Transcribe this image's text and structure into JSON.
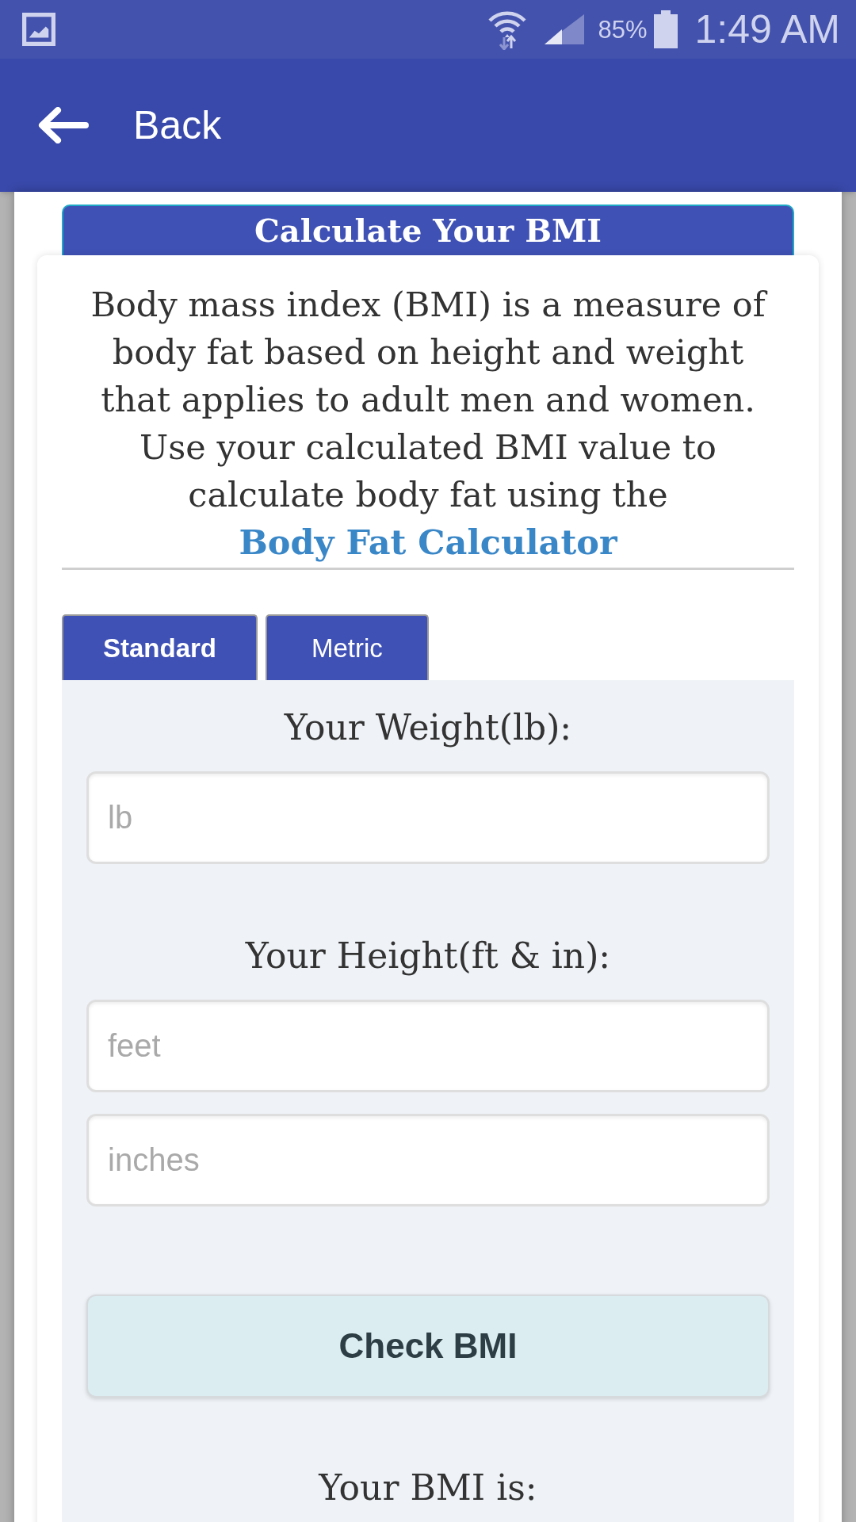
{
  "status_bar": {
    "battery": "85%",
    "time": "1:49 AM"
  },
  "app_bar": {
    "back_label": "Back"
  },
  "card": {
    "title": "Calculate Your BMI",
    "intro": "Body mass index (BMI) is a measure of body fat based on height and weight that applies to adult men and women. Use your calculated BMI value to calculate body fat using the",
    "link": "Body Fat Calculator"
  },
  "tabs": [
    {
      "label": "Standard",
      "selected": true
    },
    {
      "label": "Metric",
      "selected": false
    }
  ],
  "form": {
    "sections": [
      {
        "label": "Your Weight(lb):",
        "fields": [
          {
            "placeholder": "lb"
          }
        ]
      },
      {
        "label": "Your Height(ft & in):",
        "fields": [
          {
            "placeholder": "feet"
          },
          {
            "placeholder": "inches"
          }
        ]
      }
    ],
    "submit": "Check BMI",
    "result_label": "Your BMI is:"
  }
}
